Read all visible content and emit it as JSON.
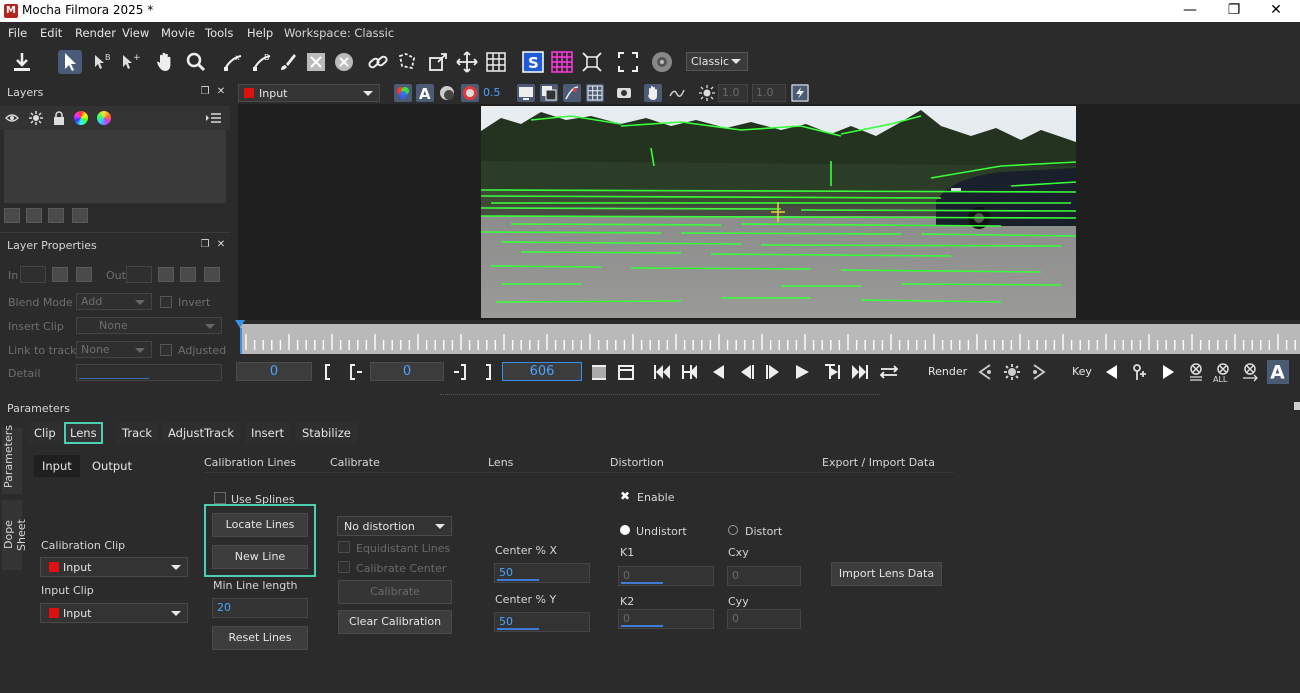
{
  "window": {
    "title": "Mocha Filmora 2025 *",
    "app_icon": "M",
    "controls": {
      "minimize": "—",
      "maximize": "❐",
      "close": "✕"
    }
  },
  "menu": [
    "File",
    "Edit",
    "View",
    "Movie",
    "Tools",
    "Help"
  ],
  "workspace": {
    "label": "Workspace: Classic",
    "selected": "Classic"
  },
  "layers_panel": {
    "title": "Layers"
  },
  "layer_properties": {
    "title": "Layer Properties",
    "in_label": "In",
    "out_label": "Out",
    "blend_mode_label": "Blend Mode",
    "blend_mode_value": "Add",
    "invert_label": "Invert",
    "insert_clip_label": "Insert Clip",
    "insert_clip_value": "None",
    "link_to_track_label": "Link to track",
    "link_to_track_value": "None",
    "adjusted_label": "Adjusted",
    "detail_label": "Detail"
  },
  "view_toolbar": {
    "input_select": "Input",
    "opacity": "0.5",
    "val1": "1.0",
    "val2": "1.0"
  },
  "transport": {
    "in_frame": "0",
    "current_frame": "0",
    "out_frame": "606",
    "render_label": "Render",
    "key_label": "Key",
    "all_label": "ALL"
  },
  "parameters": {
    "title": "Parameters",
    "tabs": [
      "Clip",
      "Lens",
      "Track",
      "AdjustTrack",
      "Insert",
      "Stabilize"
    ],
    "active_tab": "Lens",
    "side_tabs": [
      "Parameters",
      "Dope Sheet"
    ],
    "subtabs": [
      "Input",
      "Output"
    ],
    "active_subtab": "Input",
    "calibration_clip_label": "Calibration Clip",
    "calibration_clip_value": "Input",
    "input_clip_label": "Input Clip",
    "input_clip_value": "Input",
    "sections": {
      "calibration_lines": "Calibration Lines",
      "calibrate": "Calibrate",
      "lens": "Lens",
      "distortion": "Distortion",
      "export_import": "Export / Import Data"
    },
    "use_splines": "Use Splines",
    "locate_lines": "Locate Lines",
    "new_line": "New Line",
    "min_line_length_label": "Min Line length",
    "min_line_length_value": "20",
    "reset_lines": "Reset Lines",
    "distortion_model": "No distortion",
    "equidistant_lines": "Equidistant Lines",
    "calibrate_center": "Calibrate Center",
    "calibrate_button": "Calibrate",
    "clear_calibration": "Clear Calibration",
    "center_x_label": "Center % X",
    "center_x_value": "50",
    "center_y_label": "Center % Y",
    "center_y_value": "50",
    "enable_label": "Enable",
    "undistort_label": "Undistort",
    "distort_label": "Distort",
    "k1_label": "K1",
    "k1_value": "0",
    "k2_label": "K2",
    "k2_value": "0",
    "cxy_label": "Cxy",
    "cxy_value": "0",
    "cyy_label": "Cyy",
    "cyy_value": "0",
    "import_lens_data": "Import Lens Data"
  },
  "colors": {
    "accent": "#4ccfb0",
    "value_blue": "#4aa3ff",
    "track_green": "#39ff3a",
    "swatch_red": "#e01010",
    "bg": "#2b2b2b"
  }
}
